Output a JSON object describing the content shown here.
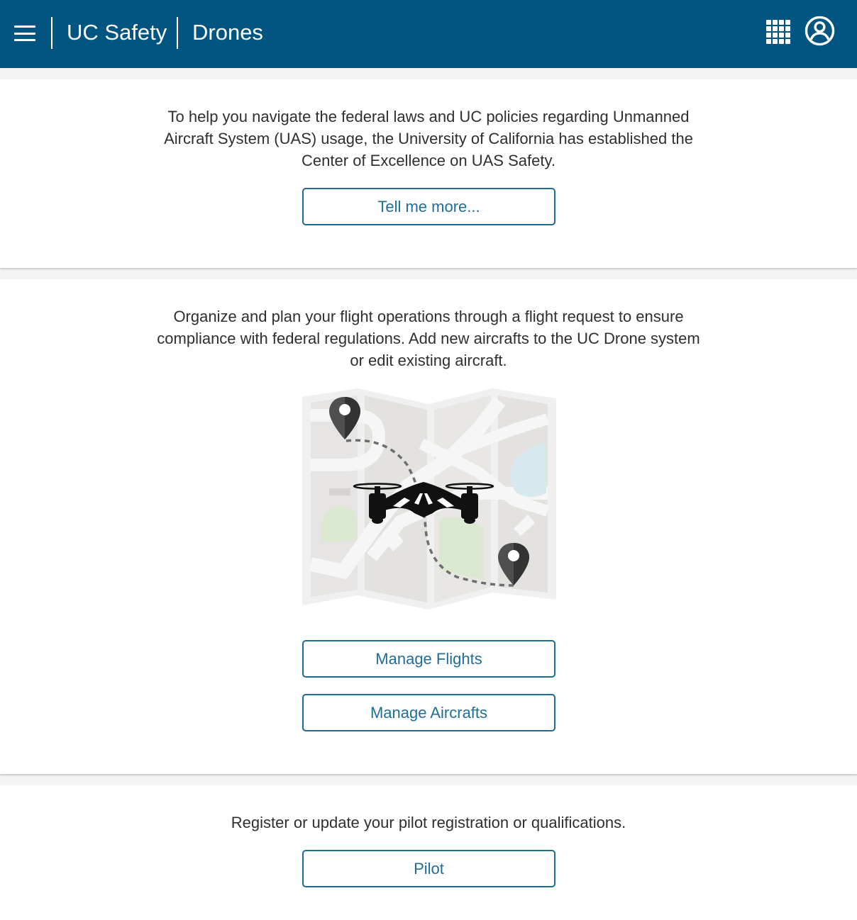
{
  "header": {
    "app_title": "UC Safety",
    "section_title": "Drones",
    "background_color": "#015580",
    "menu_icon": "hamburger-menu-icon",
    "apps_icon": "apps-grid-icon",
    "account_icon": "user-account-icon"
  },
  "intro": {
    "text_lines": [
      "To help you navigate the federal laws and UC policies regarding Unmanned",
      "Aircraft System (UAS) usage, the University of California has established the",
      "Center of Excellence on UAS Safety."
    ],
    "button_label": "Tell me more..."
  },
  "operations": {
    "text_lines": [
      "Organize and plan your flight operations through a flight request to ensure",
      "compliance with federal regulations. Add new aircrafts to the UC Drone system",
      "or edit existing aircraft."
    ],
    "illustration": "drone-flight-map-illustration",
    "buttons": {
      "flights": "Manage Flights",
      "aircrafts": "Manage Aircrafts"
    }
  },
  "pilot": {
    "text": "Register or update your pilot registration or qualifications.",
    "button_label": "Pilot"
  },
  "colors": {
    "accent": "#1b6b93",
    "page_background": "#f4f4f4"
  }
}
